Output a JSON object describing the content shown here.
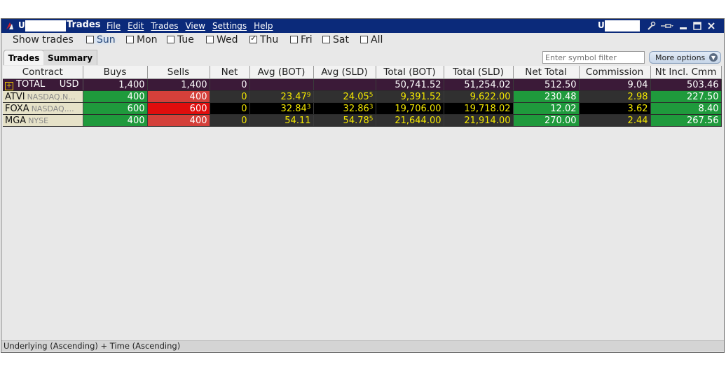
{
  "titlebar": {
    "account_left": "U1",
    "title": "Trades",
    "menu": [
      "File",
      "Edit",
      "Trades",
      "View",
      "Settings",
      "Help"
    ],
    "account_right": "U",
    "icons": [
      "wrench-icon",
      "pin-icon",
      "minimize-icon",
      "maximize-icon",
      "close-icon"
    ]
  },
  "days": {
    "label": "Show trades",
    "items": [
      {
        "label": "Sun",
        "checked": false
      },
      {
        "label": "Mon",
        "checked": false
      },
      {
        "label": "Tue",
        "checked": false
      },
      {
        "label": "Wed",
        "checked": false
      },
      {
        "label": "Thu",
        "checked": true
      },
      {
        "label": "Fri",
        "checked": false
      },
      {
        "label": "Sat",
        "checked": false
      },
      {
        "label": "All",
        "checked": false
      }
    ]
  },
  "tabs": [
    "Trades",
    "Summary"
  ],
  "filter": {
    "placeholder": "Enter symbol filter"
  },
  "more_options": "More options",
  "columns": [
    "Contract",
    "Buys",
    "Sells",
    "Net",
    "Avg (BOT)",
    "Avg (SLD)",
    "Total (BOT)",
    "Total (SLD)",
    "Net Total",
    "Commission",
    "Nt Incl. Cmm"
  ],
  "rows": {
    "total": {
      "contract": "TOTAL",
      "currency": "USD",
      "buys": "1,400",
      "sells": "1,400",
      "net": "0",
      "avg_bot": "",
      "avg_sld": "",
      "total_bot": "50,741.52",
      "total_sld": "51,254.02",
      "net_total": "512.50",
      "commission": "9.04",
      "nt_incl": "503.46"
    },
    "atvi": {
      "symbol": "ATVI",
      "exchange": "NASDAQ.N...",
      "buys": "400",
      "sells": "400",
      "net": "0",
      "avg_bot": "23.47",
      "avg_bot_sup": "9",
      "avg_sld": "24.05",
      "avg_sld_sup": "5",
      "total_bot": "9,391.52",
      "total_sld": "9,622.00",
      "net_total": "230.48",
      "commission": "2.98",
      "nt_incl": "227.50"
    },
    "foxa": {
      "symbol": "FOXA",
      "exchange": "NASDAQ....",
      "buys": "600",
      "sells": "600",
      "net": "0",
      "avg_bot": "32.84",
      "avg_bot_sup": "3",
      "avg_sld": "32.86",
      "avg_sld_sup": "3",
      "total_bot": "19,706.00",
      "total_sld": "19,718.02",
      "net_total": "12.02",
      "commission": "3.62",
      "nt_incl": "8.40"
    },
    "mga": {
      "symbol": "MGA",
      "exchange": "NYSE",
      "buys": "400",
      "sells": "400",
      "net": "0",
      "avg_bot": "54.11",
      "avg_bot_sup": "",
      "avg_sld": "54.78",
      "avg_sld_sup": "5",
      "total_bot": "21,644.00",
      "total_sld": "21,914.00",
      "net_total": "270.00",
      "commission": "2.44",
      "nt_incl": "267.56"
    }
  },
  "footer": "Underlying (Ascending)  +  Time (Ascending)"
}
